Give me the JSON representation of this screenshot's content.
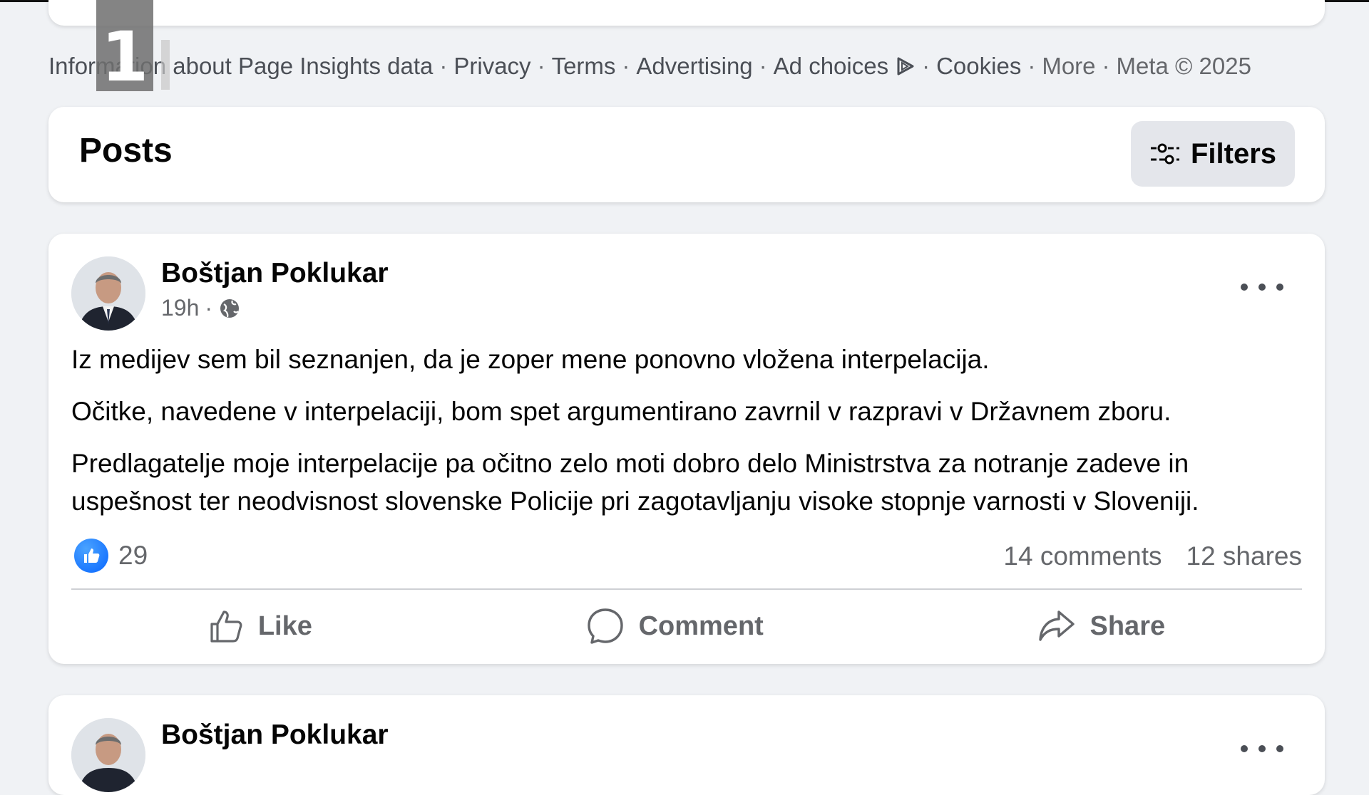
{
  "footer": {
    "links": [
      "Information about Page Insights data",
      "Privacy",
      "Terms",
      "Advertising",
      "Ad choices"
    ],
    "links_after": [
      "Cookies",
      "More",
      "Meta © 2025"
    ]
  },
  "channel_logo": "1",
  "posts_section": {
    "title": "Posts",
    "filters_label": "Filters"
  },
  "posts": [
    {
      "author": "Boštjan Poklukar",
      "time": "19h",
      "paragraphs": [
        "Iz medijev sem bil seznanjen, da je zoper mene ponovno vložena interpelacija.",
        "Očitke, navedene v interpelaciji, bom spet argumentirano zavrnil v razpravi v Državnem zboru.",
        "Predlagatelje moje interpelacije pa očitno zelo moti dobro delo Ministrstva za notranje zadeve in uspešnost ter neodvisnost slovenske Policije pri zagotavljanju visoke stopnje varnosti v Sloveniji."
      ],
      "reaction_count": "29",
      "comments": "14 comments",
      "shares": "12 shares",
      "actions": {
        "like": "Like",
        "comment": "Comment",
        "share": "Share"
      }
    },
    {
      "author": "Boštjan Poklukar"
    }
  ],
  "colors": {
    "background": "#f0f2f5",
    "like_blue": "#0866ff",
    "secondary_text": "#65676b"
  }
}
